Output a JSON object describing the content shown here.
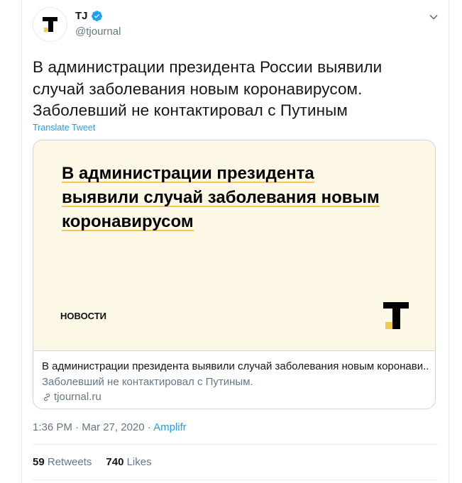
{
  "author": {
    "name": "TJ",
    "handle": "@tjournal",
    "avatar_icon": "tj-logo-icon",
    "verified_icon": "verified-badge-icon"
  },
  "tweet": {
    "text_lines": [
      "В администрации президента России выявили",
      "случай заболевания новым коронавирусом.",
      "Заболевший не контактировал с Путиным"
    ],
    "translate_label": "Translate Tweet"
  },
  "card": {
    "headline_lines": [
      "В администрации президента",
      "выявили случай заболевания новым",
      "коронавирусом"
    ],
    "label": "НОВОСТИ",
    "title": "В администрации президента выявили случай заболевания новым коронави...",
    "description": "Заболевший не контактировал с Путиным.",
    "domain": "tjournal.ru"
  },
  "meta": {
    "time": "1:36 PM",
    "separator": "·",
    "date": "Mar 27, 2020",
    "source": "Amplifr"
  },
  "stats": {
    "retweets_count": "59",
    "retweets_label": "Retweets",
    "likes_count": "740",
    "likes_label": "Likes"
  },
  "colors": {
    "accent": "#1da1f2",
    "secondary_text": "#657786",
    "card_bg": "#fdf7e5",
    "logo_yellow": "#f2c94c"
  }
}
